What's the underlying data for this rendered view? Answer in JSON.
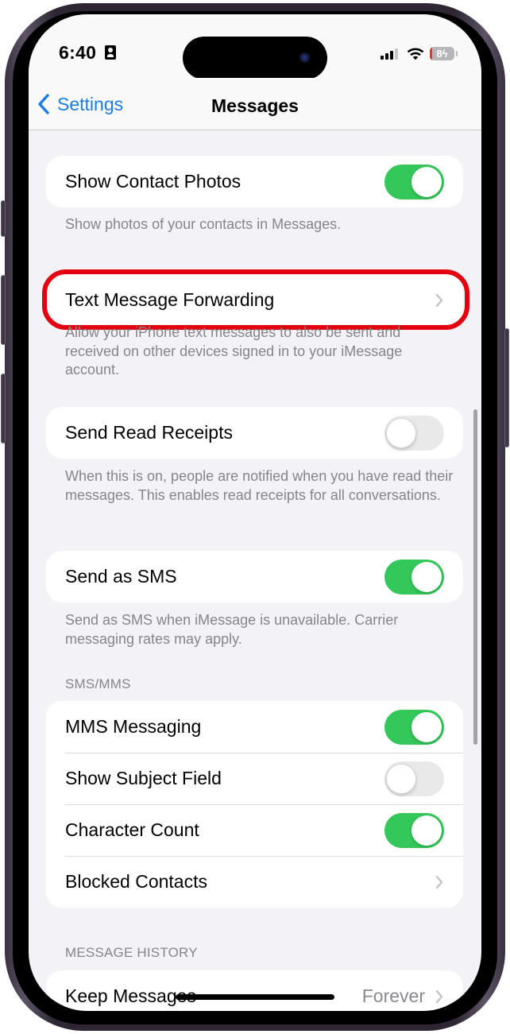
{
  "status_bar": {
    "time": "6:40",
    "battery_percent": 8,
    "battery_label": "8",
    "charging": true,
    "signal_bars": 3,
    "signal_bars_total": 4
  },
  "nav": {
    "back_label": "Settings",
    "title": "Messages"
  },
  "colors": {
    "accent": "#1b7ce6",
    "toggle_on": "#34c759",
    "toggle_off": "#e9e9ea",
    "highlight": "#e3000f",
    "background": "#f2f2f7"
  },
  "sections": {
    "contact_photos": {
      "row": {
        "label": "Show Contact Photos",
        "enabled": true
      },
      "footer": "Show photos of your contacts in Messages."
    },
    "forwarding": {
      "row": {
        "label": "Text Message Forwarding",
        "highlighted": true
      },
      "footer": "Allow your iPhone text messages to also be sent and received on other devices signed in to your iMessage account."
    },
    "read_receipts": {
      "row": {
        "label": "Send Read Receipts",
        "enabled": false
      },
      "footer": "When this is on, people are notified when you have read their messages. This enables read receipts for all conversations."
    },
    "send_sms": {
      "row": {
        "label": "Send as SMS",
        "enabled": true
      },
      "footer": "Send as SMS when iMessage is unavailable. Carrier messaging rates may apply."
    },
    "sms_mms": {
      "header": "SMS/MMS",
      "rows": [
        {
          "label": "MMS Messaging",
          "enabled": true
        },
        {
          "label": "Show Subject Field",
          "enabled": false
        },
        {
          "label": "Character Count",
          "enabled": true
        },
        {
          "label": "Blocked Contacts"
        }
      ]
    },
    "message_history": {
      "header": "MESSAGE HISTORY",
      "rows": [
        {
          "label": "Keep Messages",
          "value": "Forever"
        }
      ]
    }
  }
}
